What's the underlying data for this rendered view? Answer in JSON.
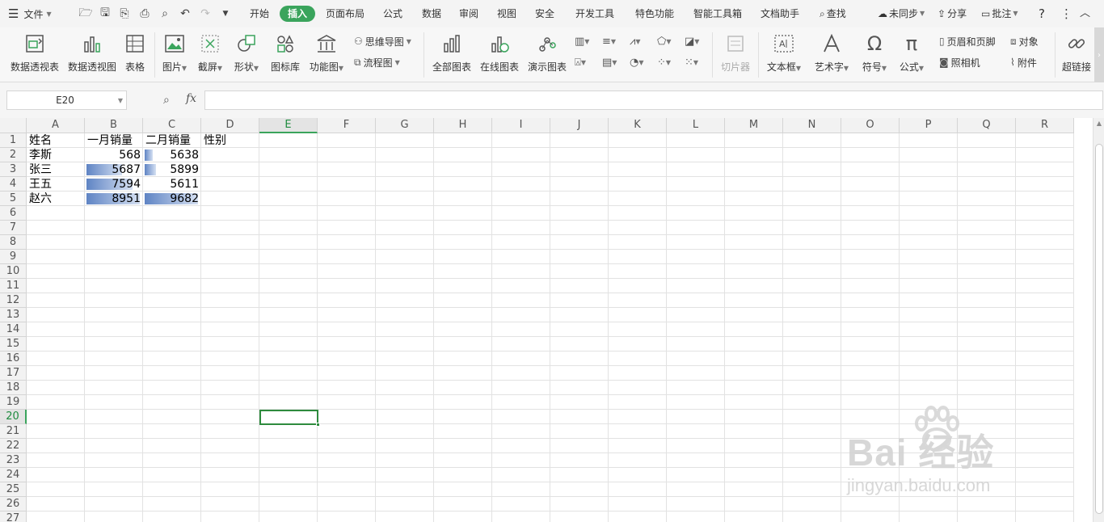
{
  "menubar": {
    "file_label": "文件",
    "tabs": [
      "开始",
      "插入",
      "页面布局",
      "公式",
      "数据",
      "审阅",
      "视图",
      "安全",
      "开发工具",
      "特色功能",
      "智能工具箱",
      "文档助手"
    ],
    "active_tab": "插入",
    "search_label": "查找",
    "sync_label": "未同步",
    "share_label": "分享",
    "comment_label": "批注",
    "help_label": "?"
  },
  "ribbon": {
    "pivot_table": "数据透视表",
    "pivot_chart": "数据透视图",
    "table": "表格",
    "picture": "图片",
    "screenshot": "截屏",
    "shape": "形状",
    "icon_library": "图标库",
    "function_chart": "功能图",
    "mind_map": "思维导图",
    "flowchart": "流程图",
    "all_charts": "全部图表",
    "online_charts": "在线图表",
    "demo_charts": "演示图表",
    "slicer": "切片器",
    "textbox": "文本框",
    "art_text": "艺术字",
    "symbol": "符号",
    "formula": "公式",
    "header_footer": "页眉和页脚",
    "object": "对象",
    "camera": "照相机",
    "attachment": "附件",
    "hyperlink": "超链接"
  },
  "formula_bar": {
    "name_box": "E20",
    "fx_label": "fx",
    "formula_value": ""
  },
  "sheet": {
    "columns": [
      "A",
      "B",
      "C",
      "D",
      "E",
      "F",
      "G",
      "H",
      "I",
      "J",
      "K",
      "L",
      "M",
      "N",
      "O",
      "P",
      "Q",
      "R"
    ],
    "rows": [
      "1",
      "2",
      "3",
      "4",
      "5",
      "6",
      "7",
      "8",
      "9",
      "10",
      "11",
      "12",
      "13",
      "14",
      "15",
      "16",
      "17",
      "18",
      "19",
      "20",
      "21",
      "22",
      "23",
      "24",
      "25",
      "26",
      "27"
    ],
    "selected_column": "E",
    "selected_row": "20",
    "header_row": [
      "姓名",
      "一月销量",
      "二月销量",
      "性别"
    ],
    "data_rows": [
      {
        "name": "李斯",
        "jan": 568,
        "feb": 5638
      },
      {
        "name": "张三",
        "jan": 5687,
        "feb": 5899
      },
      {
        "name": "王五",
        "jan": 7594,
        "feb": 5611
      },
      {
        "name": "赵六",
        "jan": 8951,
        "feb": 9682
      }
    ],
    "data_bar_color": "#5f84c4",
    "selection_color": "#2e8b3e"
  },
  "watermark": {
    "main": "Bai 经验",
    "sub": "jingyan.baidu.com"
  }
}
